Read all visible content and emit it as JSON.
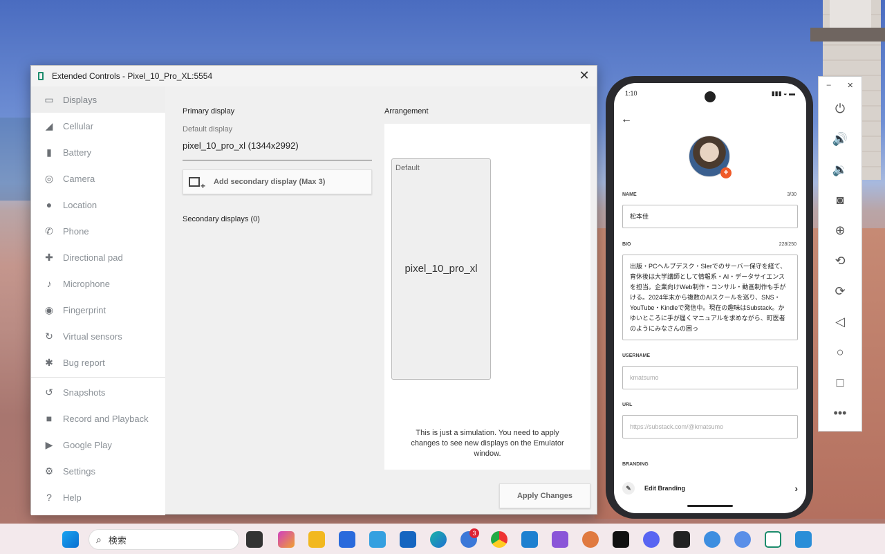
{
  "ext_controls": {
    "title": "Extended Controls - Pixel_10_Pro_XL:5554",
    "close": "✕",
    "nav": [
      {
        "label": "Displays",
        "icon": "monitor-icon"
      },
      {
        "label": "Cellular",
        "icon": "signal-icon"
      },
      {
        "label": "Battery",
        "icon": "battery-icon"
      },
      {
        "label": "Camera",
        "icon": "camera-aperture-icon"
      },
      {
        "label": "Location",
        "icon": "location-pin-icon"
      },
      {
        "label": "Phone",
        "icon": "phone-icon"
      },
      {
        "label": "Directional pad",
        "icon": "dpad-icon"
      },
      {
        "label": "Microphone",
        "icon": "microphone-icon"
      },
      {
        "label": "Fingerprint",
        "icon": "fingerprint-icon"
      },
      {
        "label": "Virtual sensors",
        "icon": "sensors-icon"
      },
      {
        "label": "Bug report",
        "icon": "bug-icon"
      },
      {
        "label": "Snapshots",
        "icon": "history-icon"
      },
      {
        "label": "Record and Playback",
        "icon": "video-camera-icon"
      },
      {
        "label": "Google Play",
        "icon": "play-icon"
      },
      {
        "label": "Settings",
        "icon": "gear-icon"
      },
      {
        "label": "Help",
        "icon": "help-icon"
      }
    ],
    "primary_display": "Primary display",
    "default_display": "Default display",
    "display_value": "pixel_10_pro_xl (1344x2992)",
    "add_secondary": "Add secondary display (Max 3)",
    "secondary_displays": "Secondary displays (0)",
    "arrangement": "Arrangement",
    "box_default": "Default",
    "box_name": "pixel_10_pro_xl",
    "note": "This is just a simulation. You need to apply changes to see new displays on the Emulator window.",
    "apply": "Apply Changes"
  },
  "phone": {
    "time": "1:10",
    "status_icons": "▮▮▮ ◒ ▬",
    "back": "←",
    "name_label": "NAME",
    "name_count": "3/30",
    "name_value": "松本佳",
    "bio_label": "BIO",
    "bio_count": "228/250",
    "bio_value": "出版・PCヘルプデスク・SIerでのサーバー保守を経て、育休後は大学講師として情報系・AI・データサイエンスを担当。企業向けWeb制作・コンサル・動画制作も手がける。2024年末から複数のAIスクールを巡り、SNS・YouTube・Kindleで発信中。現在の趣味はSubstack。かゆいところに手が届くマニュアルを求めながら、町医者のようにみなさんの困っ",
    "username_label": "USERNAME",
    "username_ph": "kmatsumo",
    "url_label": "URL",
    "url_ph": "https://substack.com/@kmatsumo",
    "branding_label": "BRANDING",
    "edit_branding": "Edit Branding"
  },
  "toolbar": {
    "minimize": "–",
    "close": "✕",
    "buttons": [
      "power-icon",
      "volume-up-icon",
      "volume-down-icon",
      "camera-icon",
      "zoom-icon",
      "rotate-left-icon",
      "rotate-right-icon",
      "back-icon",
      "home-icon",
      "overview-icon",
      "more-icon"
    ]
  },
  "taskbar": {
    "search_placeholder": "検索",
    "badge_count": "3"
  }
}
